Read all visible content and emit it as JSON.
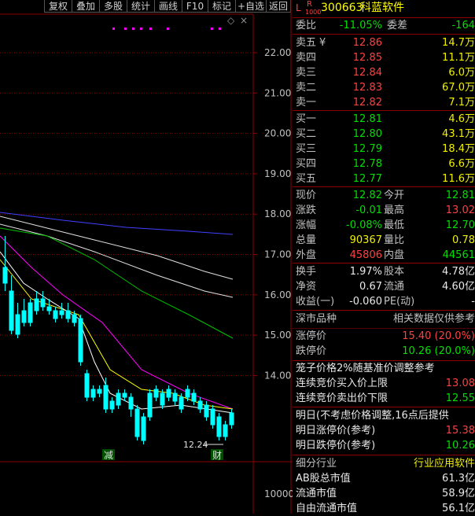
{
  "toolbar": [
    "复权",
    "叠加",
    "多股",
    "统计",
    "画线",
    "F10",
    "标记",
    "+自选",
    "返回"
  ],
  "header": {
    "tag_l": "L",
    "tag_r": "R",
    "tag_sub": "1000",
    "code": "300663",
    "name": "科蓝软件"
  },
  "weibi": {
    "label": "委比",
    "value": "-11.05%",
    "label2": "委差",
    "value2": "-164"
  },
  "asks": [
    {
      "label": "卖五",
      "mark": "¥",
      "price": "12.86",
      "vol": "14.7万"
    },
    {
      "label": "卖四",
      "price": "12.85",
      "vol": "11.1万"
    },
    {
      "label": "卖三",
      "price": "12.84",
      "vol": "6.0万"
    },
    {
      "label": "卖二",
      "price": "12.83",
      "vol": "67.0万"
    },
    {
      "label": "卖一",
      "price": "12.82",
      "vol": "7.1万"
    }
  ],
  "bids": [
    {
      "label": "买一",
      "price": "12.81",
      "vol": "4.6万"
    },
    {
      "label": "买二",
      "price": "12.80",
      "vol": "43.1万"
    },
    {
      "label": "买三",
      "price": "12.79",
      "vol": "18.4万"
    },
    {
      "label": "买四",
      "price": "12.78",
      "vol": "6.6万"
    },
    {
      "label": "买五",
      "price": "12.77",
      "vol": "11.6万"
    }
  ],
  "quote": [
    {
      "l1": "现价",
      "v1": "12.82",
      "l2": "今开",
      "v2": "12.81"
    },
    {
      "l1": "涨跌",
      "v1": "-0.01",
      "l2": "最高",
      "v2": "13.02"
    },
    {
      "l1": "涨幅",
      "v1": "-0.08%",
      "l2": "最低",
      "v2": "12.70"
    },
    {
      "l1": "总量",
      "v1": "90367",
      "l2": "量比",
      "v2": "0.78"
    },
    {
      "l1": "外盘",
      "v1": "45806",
      "l2": "内盘",
      "v2": "44561"
    }
  ],
  "stats": [
    {
      "l1": "换手",
      "v1": "1.97%",
      "l2": "股本",
      "v2": "4.78亿"
    },
    {
      "l1": "净资",
      "v1": "0.67",
      "l2": "流通",
      "v2": "4.60亿"
    },
    {
      "l1": "收益(一)",
      "v1": "-0.060",
      "l2": "PE(动)",
      "v2": "-"
    }
  ],
  "market": {
    "title": "深市品种",
    "note": "相关数据仅供参考",
    "limit_up_label": "涨停价",
    "limit_up": "15.40 (20.0%)",
    "limit_down_label": "跌停价",
    "limit_down": "10.26 (20.0%)"
  },
  "cage": {
    "title": "笼子价格2%随基准价调整参考",
    "buy_label": "连续竞价买入价上限",
    "buy": "13.08",
    "sell_label": "连续竞价卖出价下限",
    "sell": "12.55"
  },
  "tomorrow": {
    "title": "明日(不考虑价格调整,16点后提供",
    "up_label": "明日涨停价(参考)",
    "up": "15.38",
    "down_label": "明日跌停价(参考)",
    "down": "10.26"
  },
  "industry": {
    "label": "细分行业",
    "value": "行业应用软件",
    "ab_label": "AB股总市值",
    "ab": "61.3亿",
    "float_label": "流通市值",
    "float": "58.9亿",
    "free_label": "自由流通市值",
    "free": "56.1亿"
  },
  "chart": {
    "y_ticks": [
      "22.00",
      "21.00",
      "20.00",
      "19.00",
      "18.00",
      "17.00",
      "16.00",
      "15.00",
      "14.00"
    ],
    "vol_tick": "10000",
    "last_low_label": "12.24",
    "marker_jian": "减",
    "marker_cai": "财",
    "colors": {
      "up": "#ff3030",
      "down": "#00ffff",
      "ma5": "#ffffff",
      "ma10": "#ffff00",
      "ma20": "#ff00ff",
      "ma60": "#00ff00",
      "ma120": "#ffffff",
      "ma250": "#4040ff"
    }
  }
}
